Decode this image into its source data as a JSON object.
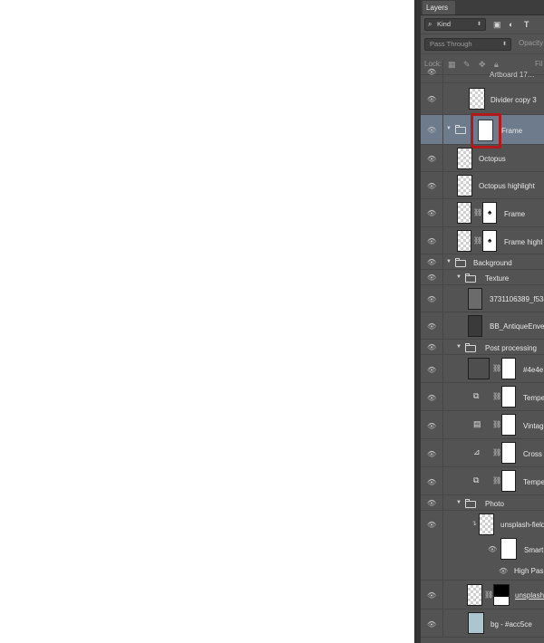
{
  "panel": {
    "tab_label": "Layers",
    "filter_kind": "Kind",
    "blend_mode": "Pass Through",
    "opacity_label": "Opacity",
    "lock_label": "Lock:",
    "fill_label": "Fil"
  },
  "layers": {
    "clipped_top": "Artboard 17…",
    "divider": "Divider copy 3",
    "frame_group": "Frame",
    "octopus": "Octopus",
    "octopus_highlight": "Octopus highlight",
    "frame": "Frame",
    "frame_highlight": "Frame highl",
    "background_group": "Background",
    "texture_group": "Texture",
    "texture_photo": "3731106389_f534",
    "antique_envelope": "BB_AntiqueEnvel",
    "post_processing_group": "Post processing",
    "fill_4e4e": "#4e4e",
    "temp1": "Tempe",
    "vintage": "Vintag",
    "cross": "Cross",
    "temp2": "Tempe",
    "photo_group": "Photo",
    "unsplash_field": "unsplash-field",
    "smart_filters": "Smart",
    "high_pass": "High Pas",
    "unsplash2": "unsplash",
    "bg": "bg - #acc5ce"
  },
  "colors": {
    "panel_bg": "#535353",
    "selected_row": "#6d7b8c",
    "highlight_box": "#b01a1a",
    "bg_swatch": "#acc5ce"
  }
}
